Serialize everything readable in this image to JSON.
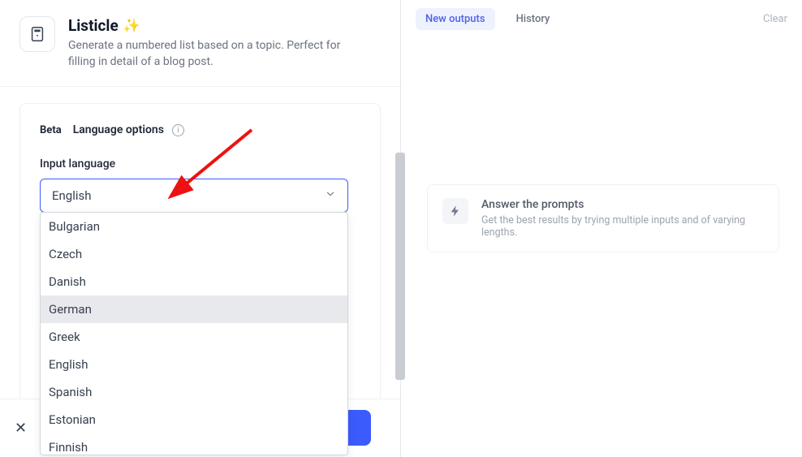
{
  "tool": {
    "title": "Listicle",
    "description": "Generate a numbered list based on a topic. Perfect for filling in detail of a blog post."
  },
  "form": {
    "beta_label": "Beta",
    "lang_options_label": "Language options",
    "input_lang_label": "Input language",
    "selected_lang": "English",
    "options": [
      "Bulgarian",
      "Czech",
      "Danish",
      "German",
      "Greek",
      "English",
      "Spanish",
      "Estonian",
      "Finnish"
    ],
    "highlighted_index": 3
  },
  "right": {
    "tab_new": "New outputs",
    "tab_history": "History",
    "clear": "Clear",
    "empty_title": "Answer the prompts",
    "empty_sub": "Get the best results by trying multiple inputs and of varying lengths."
  }
}
